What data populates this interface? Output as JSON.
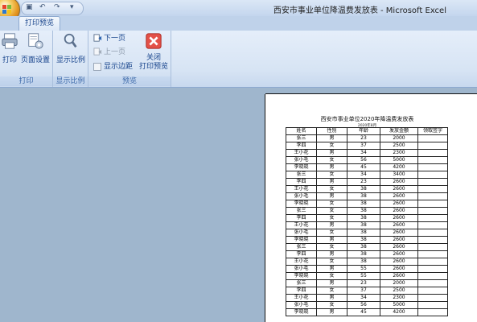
{
  "window": {
    "title": "西安市事业单位降温费发放表 - Microsoft Excel",
    "quick_access": [
      "save-icon",
      "undo-icon",
      "redo-icon",
      "customize-icon"
    ]
  },
  "tabs": [
    {
      "label": "打印预览",
      "active": true
    }
  ],
  "ribbon": {
    "groups": [
      {
        "label": "打印",
        "buttons": [
          {
            "label": "打印",
            "icon": "printer-icon"
          },
          {
            "label": "页面设置",
            "icon": "page-setup-icon"
          }
        ]
      },
      {
        "label": "显示比例",
        "buttons": [
          {
            "label": "显示比例",
            "icon": "zoom-icon"
          }
        ]
      },
      {
        "label": "预览",
        "buttons": [
          {
            "label": "下一页",
            "icon": "next-page-icon",
            "enabled": true
          },
          {
            "label": "上一页",
            "icon": "prev-page-icon",
            "enabled": false
          },
          {
            "label": "显示边距",
            "checked": false
          },
          {
            "label": "关闭\n打印预览",
            "icon": "close-preview-icon"
          }
        ]
      }
    ]
  },
  "sheet": {
    "title": "西安市事业单位2020年降温费发放表",
    "subtitle": "2020年8月",
    "headers": [
      "姓名",
      "性别",
      "年龄",
      "发放金额",
      "领取签字"
    ],
    "rows": [
      [
        "张三",
        "男",
        "23",
        "2000",
        ""
      ],
      [
        "李四",
        "女",
        "37",
        "2500",
        ""
      ],
      [
        "王小花",
        "男",
        "34",
        "2300",
        ""
      ],
      [
        "张小毛",
        "女",
        "56",
        "5000",
        ""
      ],
      [
        "李晓晓",
        "男",
        "45",
        "4200",
        ""
      ],
      [
        "张三",
        "女",
        "34",
        "3400",
        ""
      ],
      [
        "李四",
        "男",
        "23",
        "2600",
        ""
      ],
      [
        "王小花",
        "女",
        "38",
        "2600",
        ""
      ],
      [
        "张小毛",
        "男",
        "38",
        "2600",
        ""
      ],
      [
        "李晓晓",
        "女",
        "38",
        "2600",
        ""
      ],
      [
        "张三",
        "女",
        "38",
        "2600",
        ""
      ],
      [
        "李四",
        "女",
        "38",
        "2600",
        ""
      ],
      [
        "王小花",
        "男",
        "38",
        "2600",
        ""
      ],
      [
        "张小毛",
        "女",
        "38",
        "2600",
        ""
      ],
      [
        "李晓晓",
        "男",
        "38",
        "2600",
        ""
      ],
      [
        "张三",
        "女",
        "38",
        "2600",
        ""
      ],
      [
        "李四",
        "男",
        "38",
        "2600",
        ""
      ],
      [
        "王小花",
        "女",
        "38",
        "2600",
        ""
      ],
      [
        "张小毛",
        "男",
        "55",
        "2600",
        ""
      ],
      [
        "李晓晓",
        "女",
        "55",
        "2600",
        ""
      ],
      [
        "张三",
        "男",
        "23",
        "2000",
        ""
      ],
      [
        "李四",
        "女",
        "37",
        "2500",
        ""
      ],
      [
        "王小花",
        "男",
        "34",
        "2300",
        ""
      ],
      [
        "张小毛",
        "女",
        "56",
        "5000",
        ""
      ],
      [
        "李晓晓",
        "男",
        "45",
        "4200",
        ""
      ]
    ]
  }
}
